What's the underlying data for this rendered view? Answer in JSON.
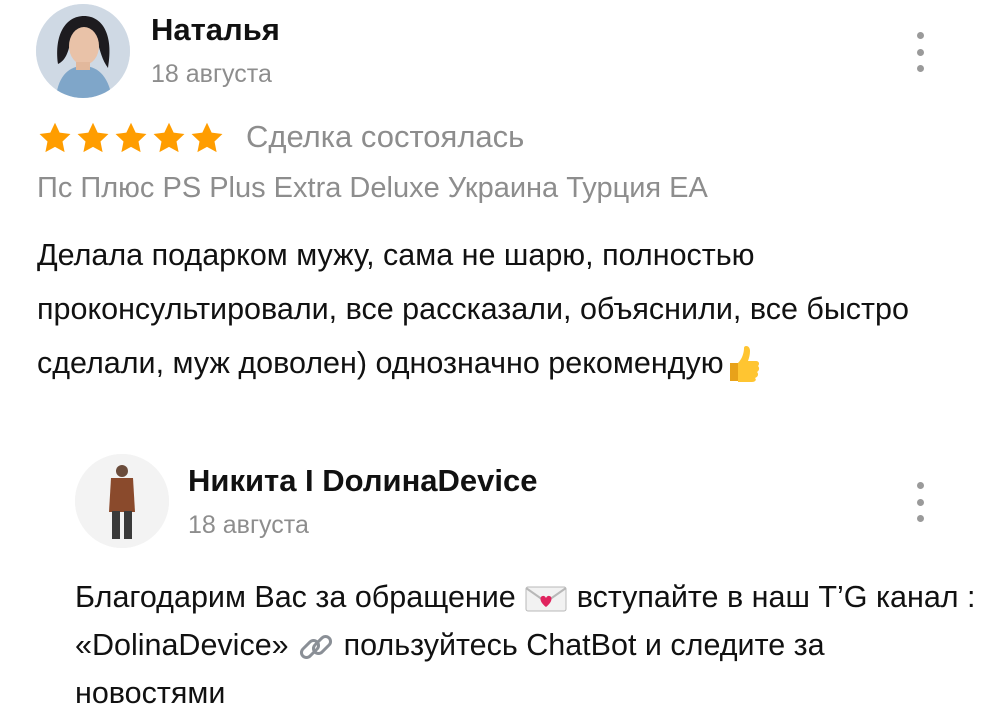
{
  "review": {
    "author": "Наталья",
    "date": "18 августа",
    "rating": 5,
    "status": "Сделка состоялась",
    "product": "Пс Плюс PS Plus Extra Deluxe Украина Турция EA",
    "text": "Делала подарком мужу, сама не шарю, полностью проконсультировали, все рассказали, объяснили, все быстро сделали, муж доволен) однозначно рекомендую"
  },
  "reply": {
    "author": "Никита I DолинаDevice",
    "date": "18 августа",
    "text_part1": "Благодарим Вас за обращение",
    "text_part2": "вступайте в наш T’G канал : «DolinaDevice»",
    "text_part3": "пользуйтесь ChatBot и следите за новостями"
  },
  "colors": {
    "star": "#ff9d00",
    "muted": "#8d8d8d",
    "text": "#111111"
  },
  "icons": {
    "review_menu": "more-vertical-icon",
    "reply_menu": "more-vertical-icon",
    "thumbs": "thumbs-up-emoji",
    "envelope": "love-letter-emoji",
    "link": "link-emoji"
  }
}
